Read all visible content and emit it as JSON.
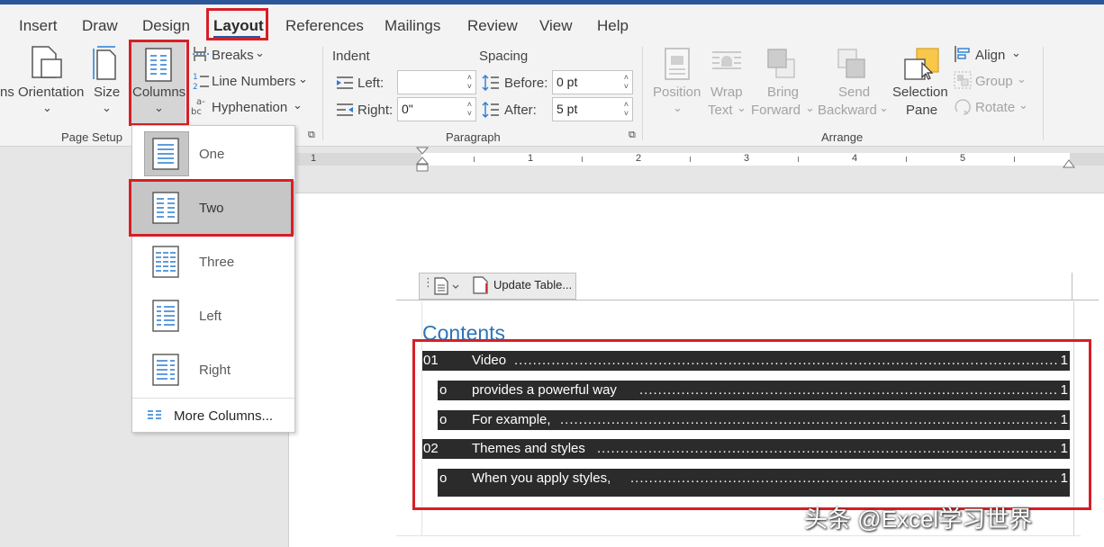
{
  "tabs": [
    "Insert",
    "Draw",
    "Design",
    "Layout",
    "References",
    "Mailings",
    "Review",
    "View",
    "Help"
  ],
  "page_setup": {
    "orientation": "ns Orientation",
    "size": "Size",
    "columns": "Columns",
    "breaks": "Breaks",
    "line_numbers": "Line Numbers",
    "hyphenation": "Hyphenation",
    "group_label": "Page Setup"
  },
  "paragraph": {
    "indent_label": "Indent",
    "spacing_label": "Spacing",
    "left_label": "Left:",
    "right_label": "Right:",
    "left_value": "",
    "right_value": "0\"",
    "before_label": "Before:",
    "after_label": "After:",
    "before_value": "0 pt",
    "after_value": "5 pt",
    "group_label": "Paragraph"
  },
  "arrange": {
    "position": [
      "Position"
    ],
    "wrap": [
      "Wrap",
      "Text"
    ],
    "bring": [
      "Bring",
      "Forward"
    ],
    "send": [
      "Send",
      "Backward"
    ],
    "selection": [
      "Selection",
      "Pane"
    ],
    "align": "Align",
    "group": "Group",
    "rotate": "Rotate",
    "group_label": "Arrange"
  },
  "ruler": [
    "1",
    "1",
    "2",
    "3",
    "4",
    "5"
  ],
  "columns_menu": {
    "items": [
      "One",
      "Two",
      "Three",
      "Left",
      "Right"
    ],
    "more": "More Columns..."
  },
  "toc": {
    "update_button": "Update Table...",
    "title": "Contents",
    "rows": [
      {
        "num": "01",
        "text": "Video",
        "page": "1"
      },
      {
        "num": "o",
        "text": "provides a powerful way",
        "page": "1"
      },
      {
        "num": "o",
        "text": "For example,",
        "page": "1"
      },
      {
        "num": "02",
        "text": "Themes and styles",
        "page": "1"
      },
      {
        "num": "o",
        "text": "When you apply styles,",
        "page": "1"
      }
    ]
  },
  "watermark": "头条 @Excel学习世界",
  "colors": {
    "accent": "#2b579a",
    "highlight": "#d61f26",
    "toc_heading": "#2e74b5"
  }
}
